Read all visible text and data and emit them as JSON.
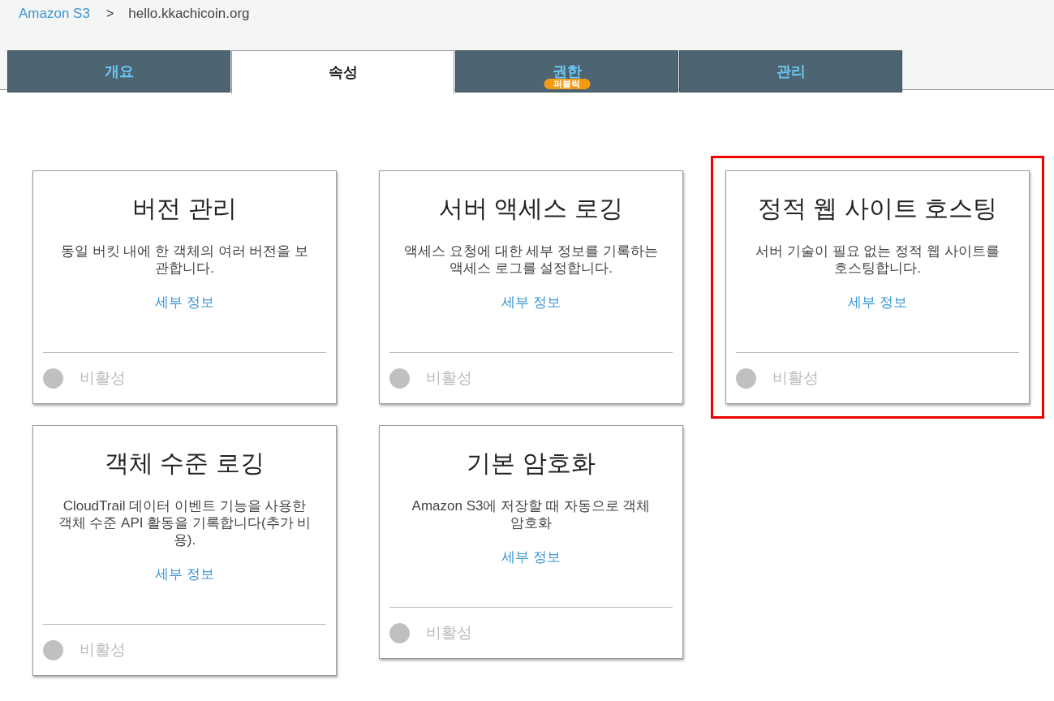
{
  "breadcrumb": {
    "root": "Amazon S3",
    "separator": ">",
    "current": "hello.kkachicoin.org"
  },
  "tabs": [
    {
      "label": "개요",
      "selected": false
    },
    {
      "label": "속성",
      "selected": true
    },
    {
      "label": "권한",
      "selected": false,
      "badge": "퍼블릭"
    },
    {
      "label": "관리",
      "selected": false
    }
  ],
  "cards": [
    {
      "title": "버전 관리",
      "description": "동일 버킷 내에 한 객체의 여러 버전을 보관합니다.",
      "link": "세부 정보",
      "status": "비활성",
      "enabled": false,
      "highlighted": false
    },
    {
      "title": "서버 액세스 로깅",
      "description": "액세스 요청에 대한 세부 정보를 기록하는 액세스 로그를 설정합니다.",
      "link": "세부 정보",
      "status": "비활성",
      "enabled": false,
      "highlighted": false
    },
    {
      "title": "정적 웹 사이트 호스팅",
      "description": "서버 기술이 필요 없는 정적 웹 사이트를 호스팅합니다.",
      "link": "세부 정보",
      "status": "비활성",
      "enabled": false,
      "highlighted": true
    },
    {
      "title": "객체 수준 로깅",
      "description": "CloudTrail 데이터 이벤트 기능을 사용한 객체 수준 API 활동을 기록합니다(추가 비용).",
      "link": "세부 정보",
      "status": "비활성",
      "enabled": false,
      "highlighted": false
    },
    {
      "title": "기본 암호화",
      "description": "Amazon S3에 저장할 때 자동으로 객체 암호화",
      "link": "세부 정보",
      "status": "비활성",
      "enabled": false,
      "highlighted": false
    }
  ]
}
